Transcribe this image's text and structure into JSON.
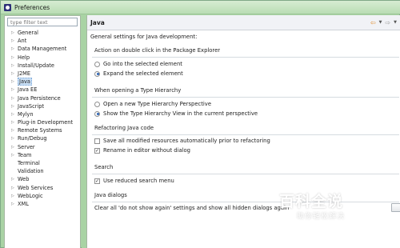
{
  "window": {
    "title": "Preferences"
  },
  "filter": {
    "placeholder": "type filter text"
  },
  "tree": [
    {
      "label": "General",
      "expandable": true
    },
    {
      "label": "Ant",
      "expandable": true
    },
    {
      "label": "Data Management",
      "expandable": true
    },
    {
      "label": "Help",
      "expandable": true
    },
    {
      "label": "Install/Update",
      "expandable": true
    },
    {
      "label": "J2ME",
      "expandable": true
    },
    {
      "label": "Java",
      "expandable": true,
      "selected": true
    },
    {
      "label": "Java EE",
      "expandable": true
    },
    {
      "label": "Java Persistence",
      "expandable": true
    },
    {
      "label": "JavaScript",
      "expandable": true
    },
    {
      "label": "Mylyn",
      "expandable": true
    },
    {
      "label": "Plug-in Development",
      "expandable": true
    },
    {
      "label": "Remote Systems",
      "expandable": true
    },
    {
      "label": "Run/Debug",
      "expandable": true
    },
    {
      "label": "Server",
      "expandable": true
    },
    {
      "label": "Team",
      "expandable": true
    },
    {
      "label": "Terminal",
      "expandable": false
    },
    {
      "label": "Validation",
      "expandable": false
    },
    {
      "label": "Web",
      "expandable": true
    },
    {
      "label": "Web Services",
      "expandable": true
    },
    {
      "label": "WebLogic",
      "expandable": true
    },
    {
      "label": "XML",
      "expandable": true
    }
  ],
  "page": {
    "title": "Java",
    "description": "General settings for Java development:",
    "groups": {
      "double_click": {
        "title": "Action on double click in the Package Explorer",
        "options": [
          {
            "label": "Go into the selected element",
            "checked": false
          },
          {
            "label": "Expand the selected element",
            "checked": true
          }
        ]
      },
      "type_hierarchy": {
        "title": "When opening a Type Hierarchy",
        "options": [
          {
            "label": "Open a new Type Hierarchy Perspective",
            "checked": false
          },
          {
            "label": "Show the Type Hierarchy View in the current perspective",
            "checked": true
          }
        ]
      },
      "refactoring": {
        "title": "Refactoring Java code",
        "options": [
          {
            "label": "Save all modified resources automatically prior to refactoring",
            "checked": false
          },
          {
            "label": "Rename in editor without dialog",
            "checked": true
          }
        ]
      },
      "search": {
        "title": "Search",
        "options": [
          {
            "label": "Use reduced search menu",
            "checked": true
          }
        ]
      },
      "dialogs": {
        "title": "Java dialogs",
        "text": "Clear all 'do not show again' settings and show all hidden dialogs again"
      }
    }
  },
  "watermark": {
    "main": "百科全说",
    "sub": "助你轻松解决"
  },
  "colors": {
    "frame": "#a9d3a4",
    "selection": "#c9dff5",
    "back_arrow": "#e08a2b"
  }
}
